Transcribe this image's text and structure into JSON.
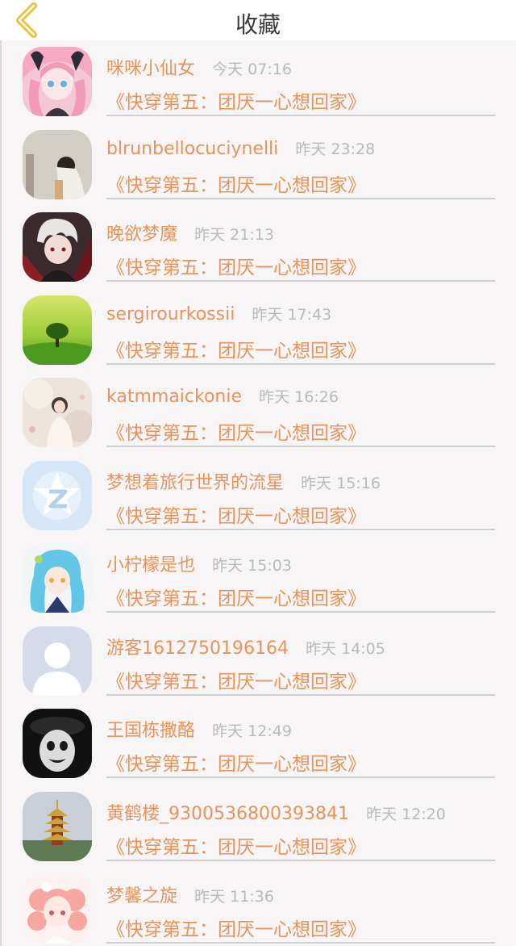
{
  "header": {
    "title": "收藏",
    "back_icon": "chevron-left-icon",
    "accent_color": "#e8c237"
  },
  "colors": {
    "name": "#e9935a",
    "time": "#b9b9b9",
    "list_background": "#f8f5f6"
  },
  "items": [
    {
      "name": "咪咪小仙女",
      "time": "今天 07:16",
      "novel": "《快穿第五：团厌一心想回家》",
      "avatar": "anime-girl-pink-avatar"
    },
    {
      "name": "blrunbellocuciynelli",
      "time": "昨天 23:28",
      "novel": "《快穿第五：团厌一心想回家》",
      "avatar": "girl-photo-avatar"
    },
    {
      "name": "晚欲梦魔",
      "time": "昨天 21:13",
      "novel": "《快穿第五：团厌一心想回家》",
      "avatar": "anime-boy-white-hair-avatar"
    },
    {
      "name": "sergirourkossii",
      "time": "昨天 17:43",
      "novel": "《快穿第五：团厌一心想回家》",
      "avatar": "tree-landscape-avatar"
    },
    {
      "name": "katmmaickonie",
      "time": "昨天 16:26",
      "novel": "《快穿第五：团厌一心想回家》",
      "avatar": "girl-white-dress-avatar"
    },
    {
      "name": "梦想着旅行世界的流星",
      "time": "昨天 15:16",
      "novel": "《快穿第五：团厌一心想回家》",
      "avatar": "qq-star-avatar"
    },
    {
      "name": "小柠檬是也",
      "time": "昨天 15:03",
      "novel": "《快穿第五：团厌一心想回家》",
      "avatar": "anime-blue-hair-avatar"
    },
    {
      "name": "游客1612750196164",
      "time": "昨天 14:05",
      "novel": "《快穿第五：团厌一心想回家》",
      "avatar": "default-user-avatar"
    },
    {
      "name": "王国栋撒酪",
      "time": "昨天 12:49",
      "novel": "《快穿第五：团厌一心想回家》",
      "avatar": "clown-bw-avatar"
    },
    {
      "name": "黄鹤楼_9300536800393841",
      "time": "昨天 12:20",
      "novel": "《快穿第五：团厌一心想回家》",
      "avatar": "pagoda-tower-avatar"
    },
    {
      "name": "梦馨之旋",
      "time": "昨天 11:36",
      "novel": "《快穿第五：团厌一心想回家》",
      "avatar": "anime-pink-curls-avatar"
    }
  ]
}
